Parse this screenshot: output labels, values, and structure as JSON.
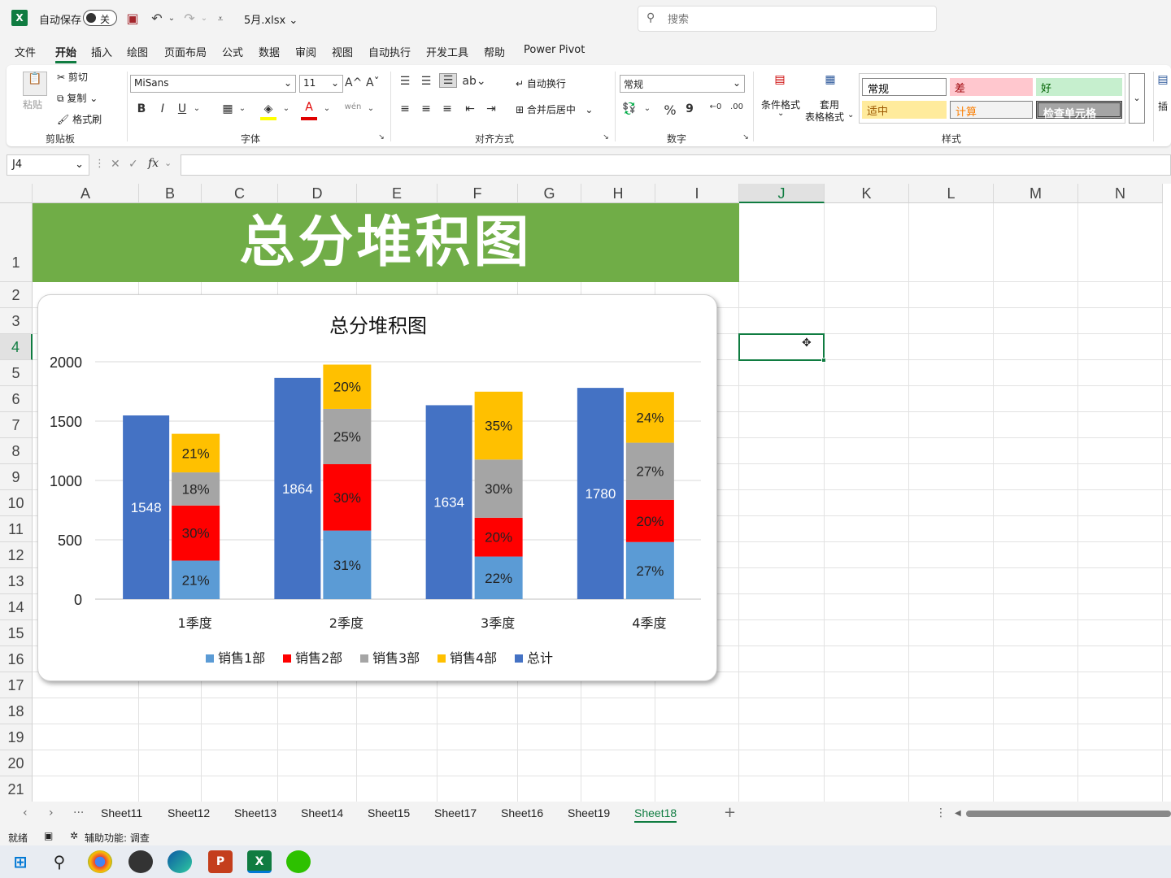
{
  "titlebar": {
    "logo": "X",
    "autosave_label": "自动保存",
    "autosave_state": "关",
    "filename": "5月.xlsx",
    "search_placeholder": "搜索"
  },
  "menu": [
    "文件",
    "开始",
    "插入",
    "绘图",
    "页面布局",
    "公式",
    "数据",
    "审阅",
    "视图",
    "自动执行",
    "开发工具",
    "帮助",
    "Power Pivot"
  ],
  "ribbon": {
    "clipboard": {
      "paste": "粘贴",
      "cut": "剪切",
      "copy": "复制",
      "format_painter": "格式刷",
      "label": "剪贴板"
    },
    "font": {
      "family": "MiSans",
      "size": "11",
      "label": "字体",
      "grow": "A^",
      "shrink": "Aˇ",
      "bold": "B",
      "italic": "I",
      "underline": "U",
      "font_color_glyph": "A",
      "phonetic_glyph": "wén",
      "font_color": "#e00000",
      "fill_color": "#ffff00"
    },
    "alignment": {
      "wrap": "自动换行",
      "merge": "合并后居中",
      "label": "对齐方式"
    },
    "number": {
      "format": "常规",
      "label": "数字",
      "percent": "%",
      "comma": "9"
    },
    "styles": {
      "conditional": "条件格式",
      "table_format_1": "套用",
      "table_format_2": "表格格式",
      "label": "样式",
      "cells": [
        {
          "text": "常规",
          "bg": "#ffffff",
          "fg": "#000000"
        },
        {
          "text": "差",
          "bg": "#ffc7ce",
          "fg": "#9c0006"
        },
        {
          "text": "好",
          "bg": "#c6efce",
          "fg": "#006100"
        },
        {
          "text": "适中",
          "bg": "#ffeb9c",
          "fg": "#9c5700"
        },
        {
          "text": "计算",
          "bg": "#f2f2f2",
          "fg": "#fa7d00"
        },
        {
          "text": "检查单元格",
          "bg": "#a5a5a5",
          "fg": "#ffffff"
        }
      ]
    },
    "insert": "插"
  },
  "formula": {
    "cell_ref": "J4",
    "fx": "fx",
    "value": ""
  },
  "grid": {
    "columns": [
      "A",
      "B",
      "C",
      "D",
      "E",
      "F",
      "G",
      "H",
      "I",
      "J",
      "K",
      "L",
      "M",
      "N"
    ],
    "selected_column": "J",
    "rows": [
      "1",
      "2",
      "3",
      "4",
      "5",
      "6",
      "7",
      "8",
      "9",
      "10",
      "11",
      "12",
      "13",
      "14",
      "15",
      "16",
      "17",
      "18",
      "19",
      "20",
      "21"
    ],
    "selected_row": "4",
    "banner_text": "总分堆积图",
    "banner_color": "#70ad47"
  },
  "chart_data": {
    "type": "bar",
    "title": "总分堆积图",
    "categories": [
      "1季度",
      "2季度",
      "3季度",
      "4季度"
    ],
    "ylim": [
      0,
      2000
    ],
    "yticks": [
      "0",
      "500",
      "1000",
      "1500",
      "2000"
    ],
    "totals": {
      "name": "总计",
      "values": [
        1548,
        1864,
        1634,
        1780
      ],
      "color": "#4472c4"
    },
    "series": [
      {
        "name": "销售1部",
        "color": "#5b9bd5",
        "labels": [
          "21%",
          "31%",
          "22%",
          "27%"
        ],
        "values": [
          325,
          578,
          359,
          481
        ]
      },
      {
        "name": "销售2部",
        "color": "#ff0000",
        "labels": [
          "30%",
          "30%",
          "20%",
          "20%"
        ],
        "values": [
          464,
          559,
          327,
          356
        ]
      },
      {
        "name": "销售3部",
        "color": "#a5a5a5",
        "labels": [
          "18%",
          "25%",
          "30%",
          "27%"
        ],
        "values": [
          279,
          466,
          490,
          481
        ]
      },
      {
        "name": "销售4部",
        "color": "#ffc000",
        "labels": [
          "21%",
          "20%",
          "35%",
          "24%"
        ],
        "values": [
          325,
          373,
          572,
          427
        ]
      }
    ],
    "legend_order": [
      "销售1部",
      "销售2部",
      "销售3部",
      "销售4部",
      "总计"
    ],
    "legend_position": "bottom",
    "grid": true
  },
  "sheets": [
    "Sheet11",
    "Sheet12",
    "Sheet13",
    "Sheet14",
    "Sheet15",
    "Sheet17",
    "Sheet16",
    "Sheet19",
    "Sheet18"
  ],
  "active_sheet": "Sheet18",
  "status": {
    "ready": "就绪",
    "accessibility": "辅助功能: 调查"
  },
  "taskbar": [
    "windows-start",
    "search",
    "chrome",
    "app",
    "edge",
    "powerpoint",
    "excel",
    "wechat"
  ]
}
